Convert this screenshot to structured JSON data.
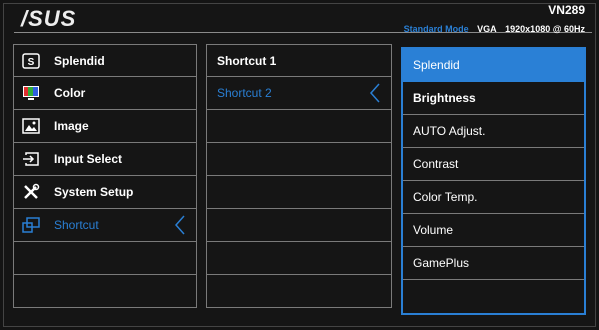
{
  "header": {
    "logo": "/SUS",
    "model": "VN289",
    "mode": "Standard Mode",
    "input": "VGA",
    "resolution": "1920x1080 @ 60Hz"
  },
  "main_menu": [
    {
      "label": "Splendid",
      "icon": "splendid-icon"
    },
    {
      "label": "Color",
      "icon": "color-icon"
    },
    {
      "label": "Image",
      "icon": "image-icon"
    },
    {
      "label": "Input Select",
      "icon": "input-select-icon"
    },
    {
      "label": "System Setup",
      "icon": "system-setup-icon"
    },
    {
      "label": "Shortcut",
      "icon": "shortcut-icon",
      "active": true
    }
  ],
  "sub_menu": [
    {
      "label": "Shortcut 1"
    },
    {
      "label": "Shortcut 2",
      "active": true
    }
  ],
  "options": [
    {
      "label": "Splendid",
      "selected": true
    },
    {
      "label": "Brightness",
      "bold": true
    },
    {
      "label": "AUTO Adjust."
    },
    {
      "label": "Contrast"
    },
    {
      "label": "Color Temp."
    },
    {
      "label": "Volume"
    },
    {
      "label": "GamePlus"
    }
  ],
  "colors": {
    "accent": "#2a7fd4",
    "border": "#7a7a7a",
    "background": "#151515"
  }
}
